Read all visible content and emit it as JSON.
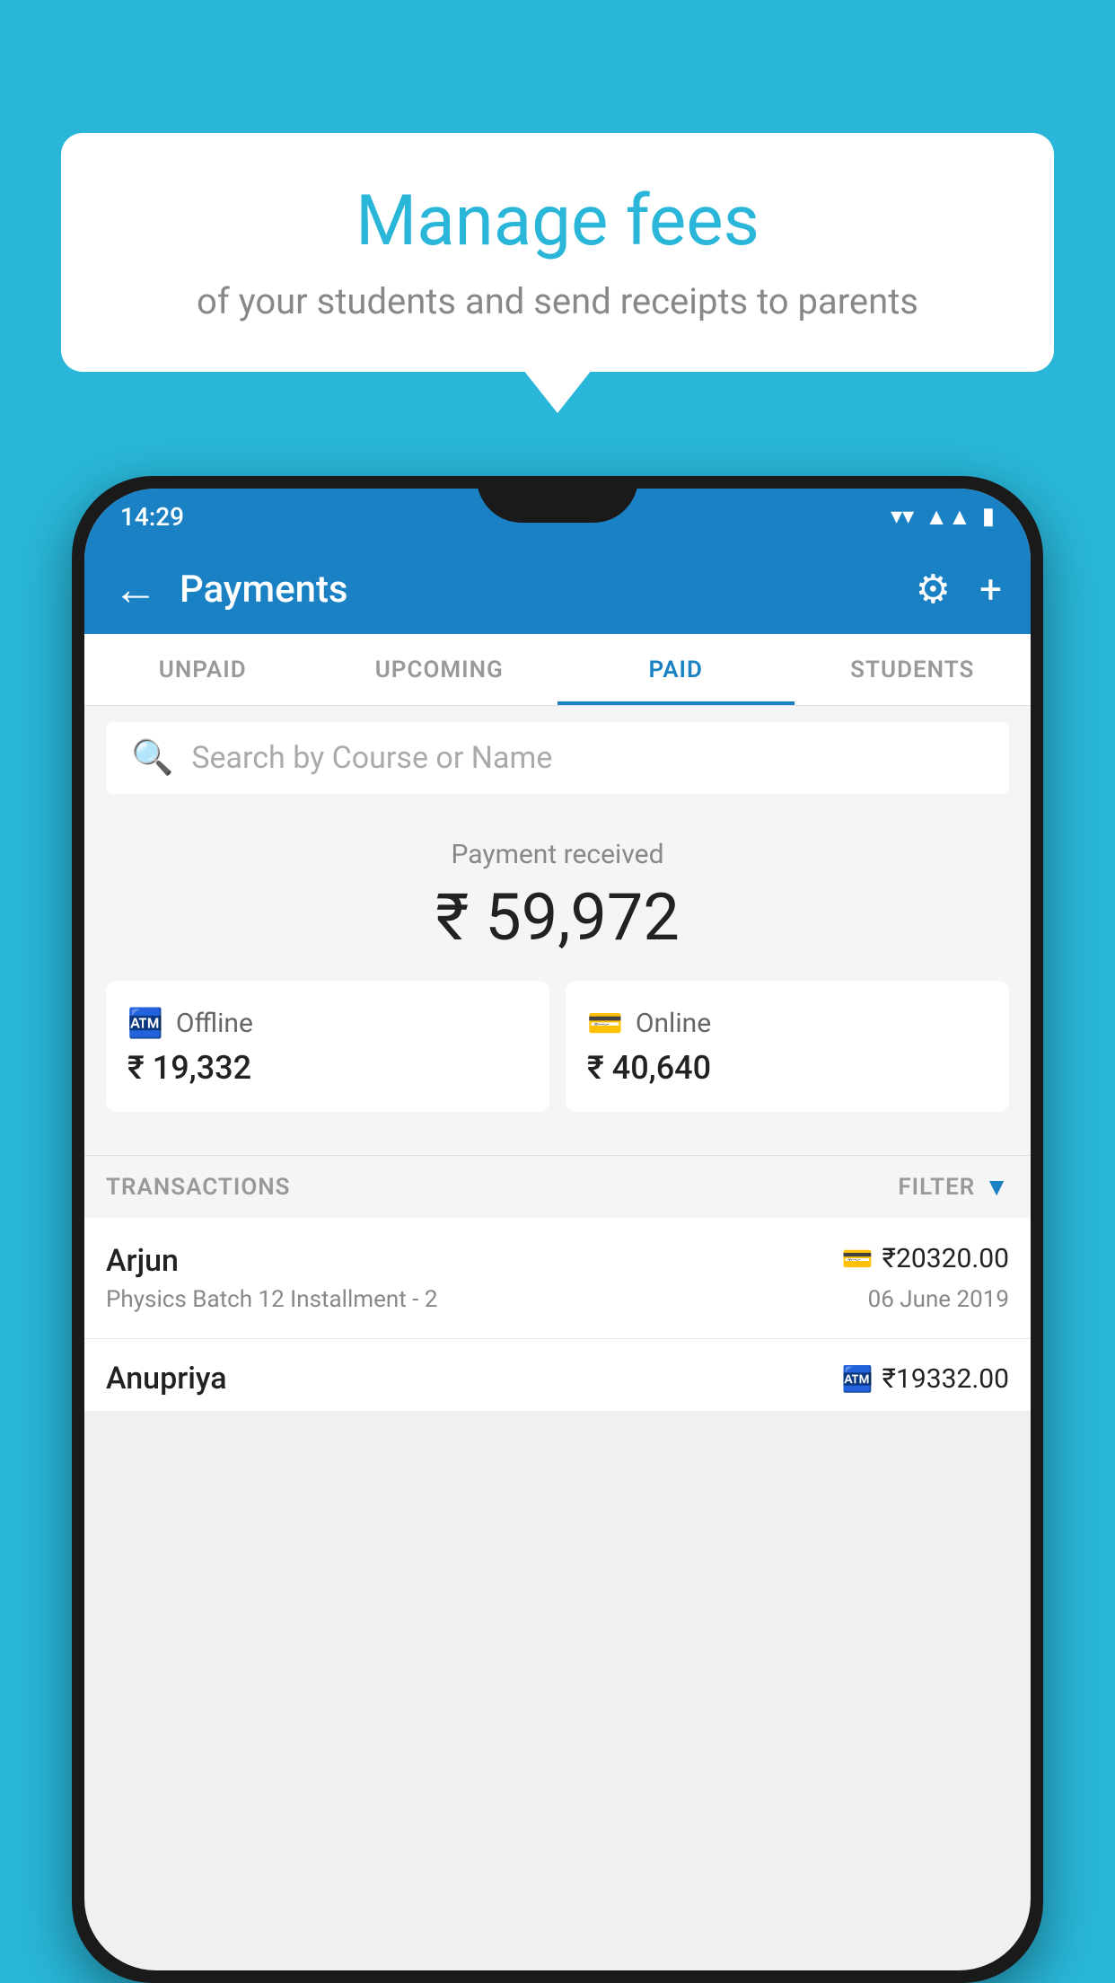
{
  "background_color": "#29b6d8",
  "bubble": {
    "title": "Manage fees",
    "subtitle": "of your students and send receipts to parents"
  },
  "status_bar": {
    "time": "14:29",
    "wifi": "▾",
    "signal": "▲",
    "battery": "▮"
  },
  "app_bar": {
    "title": "Payments",
    "back_label": "←",
    "gear_label": "⚙",
    "plus_label": "+"
  },
  "tabs": [
    {
      "label": "UNPAID",
      "active": false
    },
    {
      "label": "UPCOMING",
      "active": false
    },
    {
      "label": "PAID",
      "active": true
    },
    {
      "label": "STUDENTS",
      "active": false
    }
  ],
  "search": {
    "placeholder": "Search by Course or Name"
  },
  "payment_section": {
    "label": "Payment received",
    "amount": "₹ 59,972",
    "offline": {
      "label": "Offline",
      "amount": "₹ 19,332"
    },
    "online": {
      "label": "Online",
      "amount": "₹ 40,640"
    }
  },
  "transactions": {
    "header_label": "TRANSACTIONS",
    "filter_label": "FILTER",
    "items": [
      {
        "name": "Arjun",
        "type_icon": "card",
        "amount": "₹20320.00",
        "course": "Physics Batch 12 Installment - 2",
        "date": "06 June 2019"
      },
      {
        "name": "Anupriya",
        "type_icon": "cash",
        "amount": "₹19332.00",
        "course": "",
        "date": ""
      }
    ]
  }
}
